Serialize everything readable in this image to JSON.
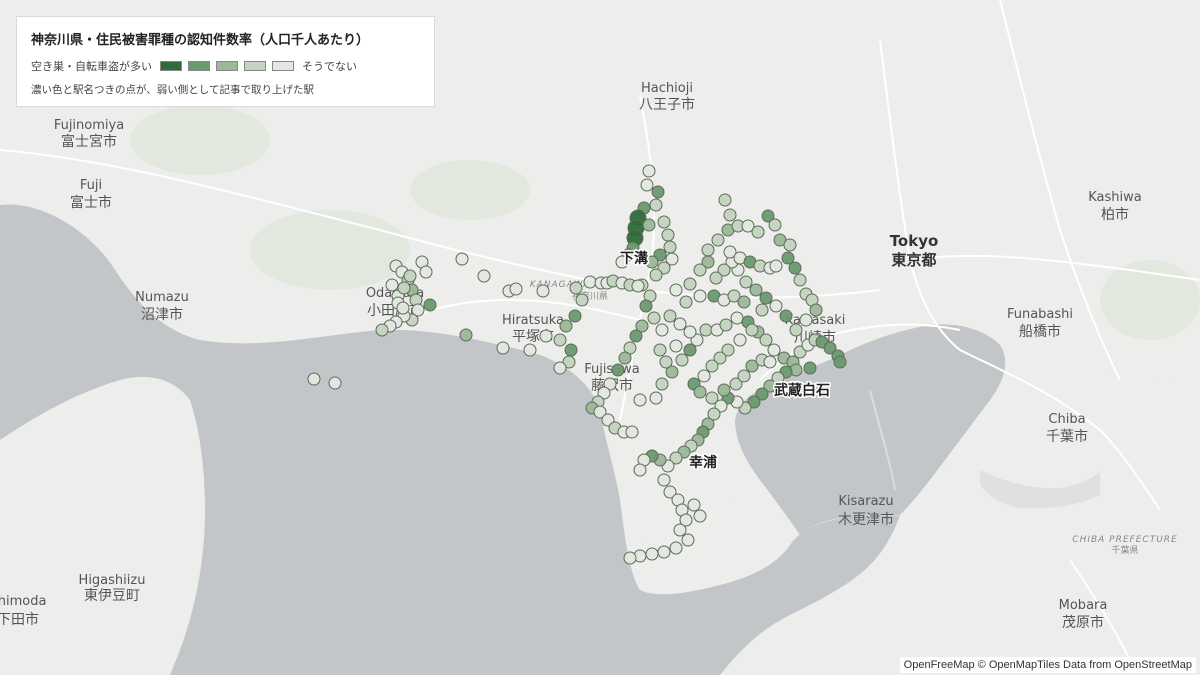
{
  "legend": {
    "title": "神奈川県・住民被害罪種の認知件数率（人口千人あたり）",
    "scale_high_label": "空き巣・自転車盗が多い",
    "scale_low_label": "そうでない",
    "scale_colors": [
      "#2e6b3a",
      "#6c9a6f",
      "#9bb897",
      "#c4d4c0",
      "#e3e8e0"
    ],
    "note": "濃い色と駅名つきの点が、弱い側として記事で取り上げた駅"
  },
  "places": [
    {
      "en": "Hachioji",
      "ja": "八王子市"
    },
    {
      "en": "Fujinomiya",
      "ja": "富士宮市"
    },
    {
      "en": "Fuji",
      "ja": "富士市"
    },
    {
      "en": "Numazu",
      "ja": "沼津市"
    },
    {
      "en": "Odawara",
      "ja": "小田原市"
    },
    {
      "en": "Hiratsuka",
      "ja": "平塚市"
    },
    {
      "en": "Fujisawa",
      "ja": "藤沢市"
    },
    {
      "en": "Kawasaki",
      "ja": "川崎市"
    },
    {
      "en": "Tokyo",
      "ja": "東京都"
    },
    {
      "en": "Kashiwa",
      "ja": "柏市"
    },
    {
      "en": "Funabashi",
      "ja": "船橋市"
    },
    {
      "en": "Chiba",
      "ja": "千葉市"
    },
    {
      "en": "Kisarazu",
      "ja": "木更津市"
    },
    {
      "en": "Mobara",
      "ja": "茂原市"
    },
    {
      "en": "Higashiizu",
      "ja": "東伊豆町"
    },
    {
      "en": "Shimoda",
      "ja": "下田市"
    }
  ],
  "prefectures": [
    {
      "en": "KANAGAWA",
      "ja": "神奈川県"
    },
    {
      "en": "CHIBA PREFECTURE",
      "ja": "千葉県"
    }
  ],
  "highlighted_stations": [
    "下溝",
    "武蔵白石",
    "幸浦"
  ],
  "attribution": "OpenFreeMap © OpenMapTiles Data from OpenStreetMap"
}
